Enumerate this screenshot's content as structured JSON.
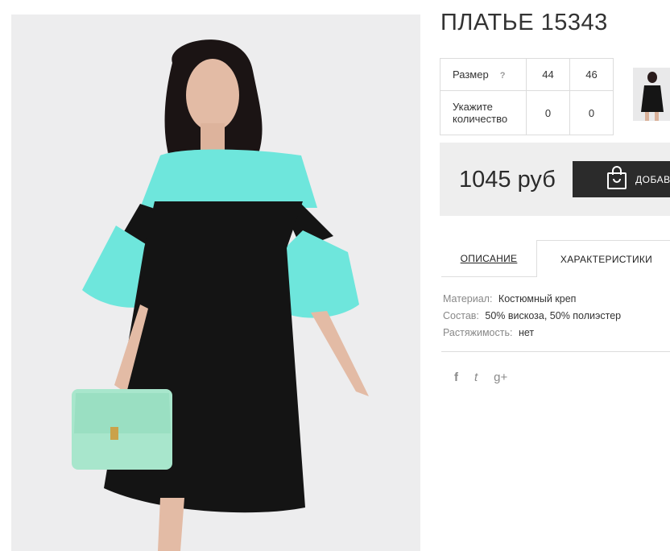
{
  "product": {
    "title": "ПЛАТЬЕ 15343"
  },
  "sizes": {
    "size_label": "Размер",
    "help_mark": "?",
    "values": [
      "44",
      "46"
    ],
    "qty_label": "Укажите количество",
    "quantities": [
      "0",
      "0"
    ]
  },
  "price": {
    "amount": "1045 руб",
    "buy_label": "ДОБАВ"
  },
  "tabs": [
    {
      "label": "ОПИСАНИЕ"
    },
    {
      "label": "ХАРАКТЕРИСТИКИ"
    }
  ],
  "characteristics": [
    {
      "key": "Материал:",
      "value": "Костюмный креп"
    },
    {
      "key": "Состав:",
      "value": "50% вискоза, 50% полиэстер"
    },
    {
      "key": "Растяжимость:",
      "value": "нет"
    }
  ],
  "social": [
    "facebook-icon",
    "twitter-icon",
    "google-plus-icon"
  ],
  "social_glyphs": [
    "f",
    "t",
    "g+"
  ],
  "colors": {
    "accent_dark": "#2b2b2b",
    "dress_black": "#141414",
    "dress_mint": "#6ee6dc",
    "bag_mint": "#a8e6cc"
  }
}
